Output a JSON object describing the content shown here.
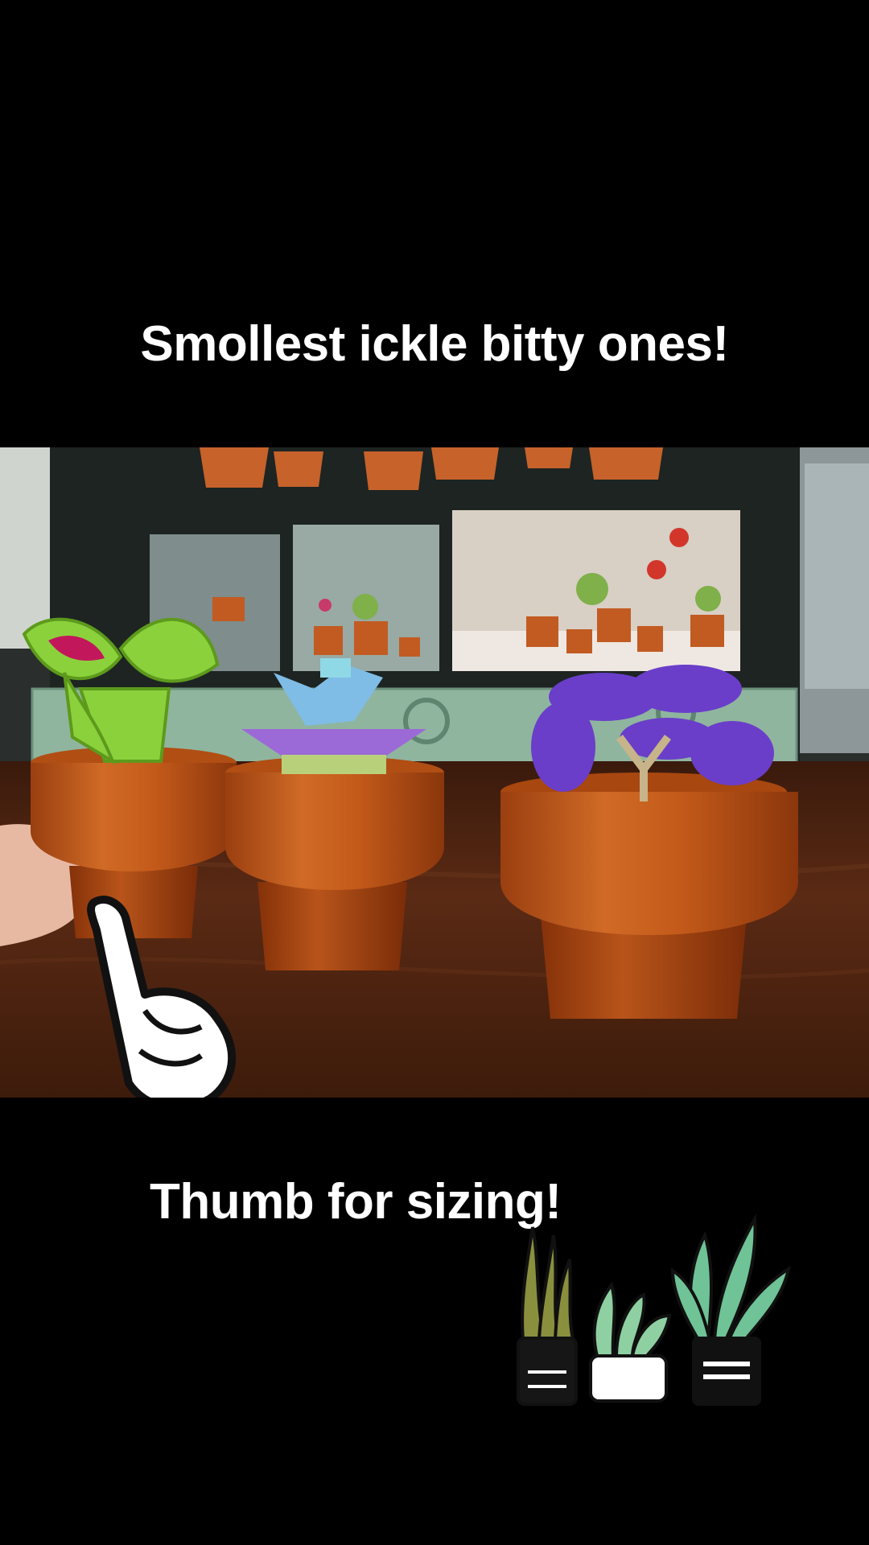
{
  "captions": {
    "top": "Smollest ickle bitty ones!",
    "bottom": "Thumb for sizing!"
  },
  "stickers": [
    "pointing-hand-icon",
    "potted-plants-icon"
  ],
  "colors": {
    "background": "#000000",
    "caption_text": "#ffffff",
    "pot": "#c0581c",
    "table": "#4a2312"
  }
}
